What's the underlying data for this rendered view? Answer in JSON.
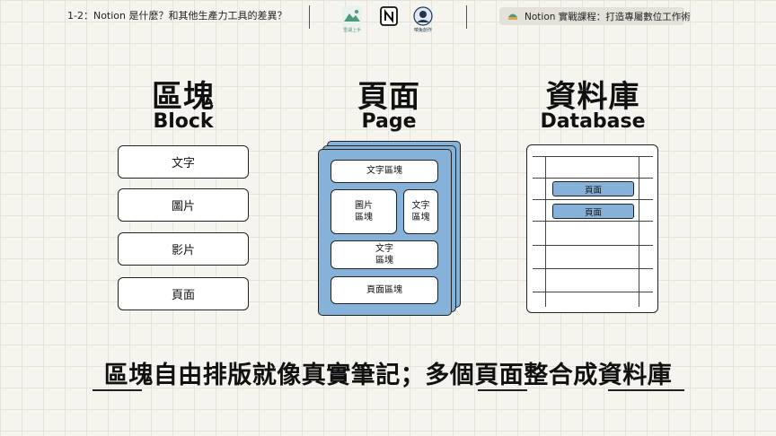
{
  "header": {
    "lesson_title": "1-2：Notion 是什麼？和其他生產力工具的差異？",
    "course_title": "Notion 實戰課程：打造專屬數位工作術",
    "logos": [
      {
        "icon": "mountain-logo-icon",
        "label": "雪湖上手"
      },
      {
        "icon": "notion-logo-icon",
        "label": ""
      },
      {
        "icon": "avatar-logo-icon",
        "label": "噴兔創作"
      }
    ],
    "colors": {
      "accent_blue": "#86b1d8",
      "background": "#f6f4ee",
      "logo_green": "#4f9a7e"
    }
  },
  "columns": {
    "block": {
      "title_zh": "區塊",
      "title_en": "Block",
      "items": [
        "文字",
        "圖片",
        "影片",
        "頁面"
      ]
    },
    "page": {
      "title_zh": "頁面",
      "title_en": "Page",
      "cards": [
        "文字區塊",
        "圖片\n區塊",
        "文字\n區塊",
        "文字\n區塊",
        "頁面區塊"
      ]
    },
    "database": {
      "title_zh": "資料庫",
      "title_en": "Database",
      "rows": [
        "頁面",
        "頁面"
      ]
    }
  },
  "caption": {
    "text": "區塊自由排版就像真實筆記；多個頁面整合成資料庫",
    "underlined": [
      "區塊",
      "頁面",
      "資料庫"
    ]
  }
}
